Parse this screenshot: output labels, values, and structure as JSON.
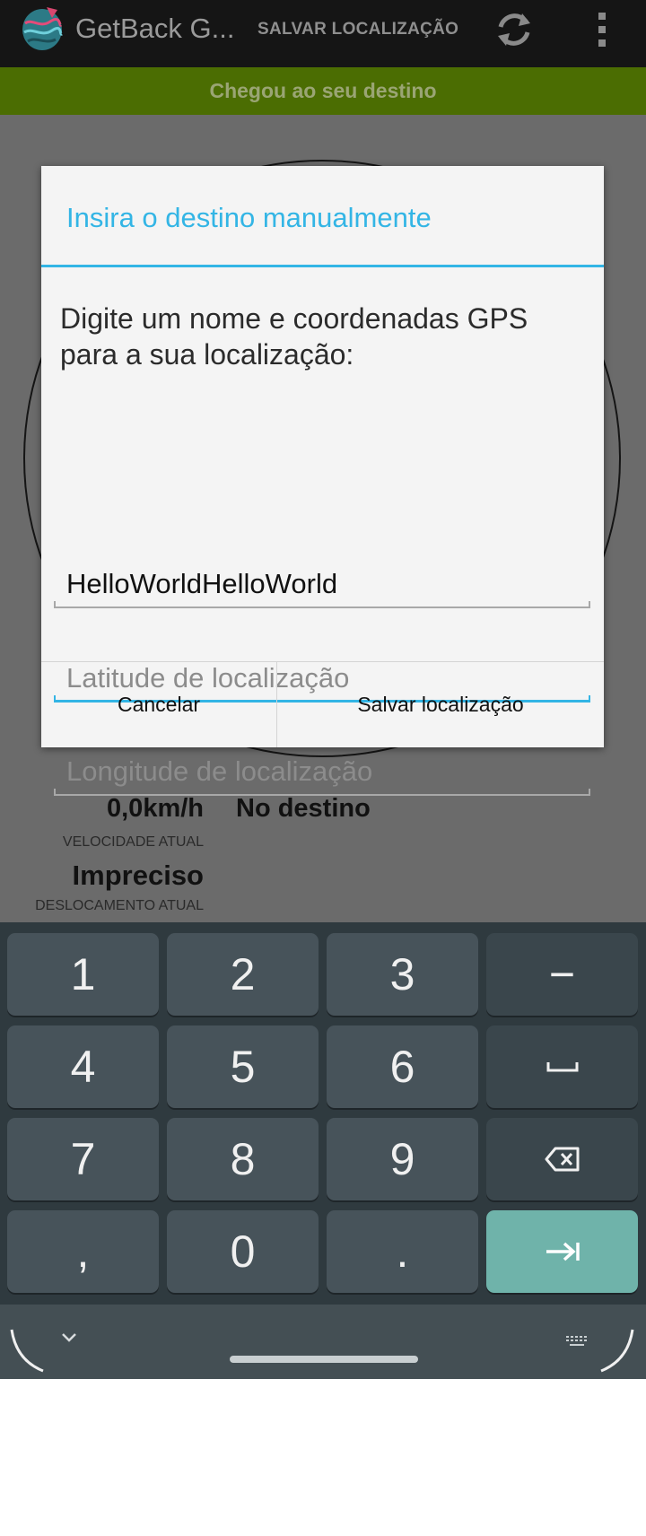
{
  "action_bar": {
    "app_title": "GetBack G...",
    "save_action": "SALVAR LOCALIZAÇÃO"
  },
  "status": {
    "message": "Chegou ao seu destino"
  },
  "info": {
    "speed_value": "0,0km/h",
    "speed_label": "VELOCIDADE ATUAL",
    "destination_status": "No destino",
    "displacement_value": "Impreciso",
    "displacement_label": "DESLOCAMENTO ATUAL"
  },
  "dialog": {
    "title": "Insira o destino manualmente",
    "message": "Digite um nome e coordenadas GPS para a sua localização:",
    "name_value": "HelloWorldHelloWorld",
    "latitude_placeholder": "Latitude de localização",
    "longitude_placeholder": "Longitude de localização",
    "cancel_label": "Cancelar",
    "save_label": "Salvar localização"
  },
  "keyboard": {
    "row1": [
      "1",
      "2",
      "3",
      "−"
    ],
    "row2": [
      "4",
      "5",
      "6"
    ],
    "row3": [
      "7",
      "8",
      "9"
    ],
    "row4": [
      ",",
      "0",
      "."
    ]
  },
  "icons": {
    "refresh": "refresh-icon",
    "overflow": "overflow-menu-icon",
    "space": "space-key-icon",
    "backspace": "backspace-icon",
    "enter": "tab-next-icon"
  },
  "colors": {
    "accent": "#33b5e5",
    "status_green": "#4b6d02",
    "enter_key": "#6fb3aa",
    "keyboard_bg": "#2f3a3f"
  }
}
